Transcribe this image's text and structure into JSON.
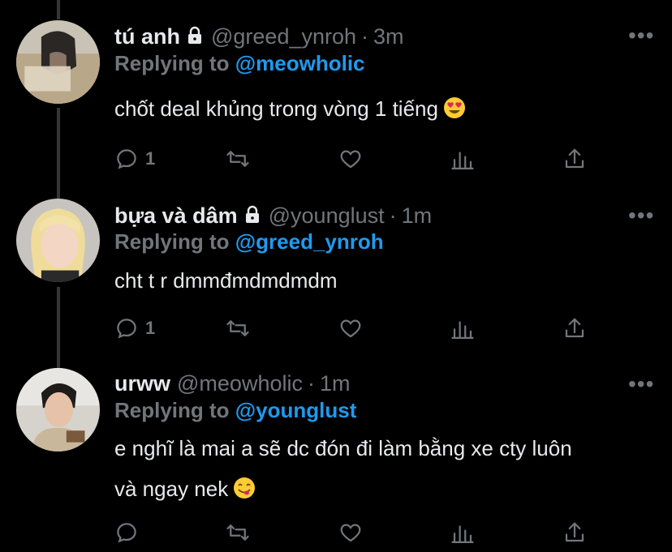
{
  "tweets": [
    {
      "name": "tú anh",
      "handle": "@greed_ynroh",
      "separator": "·",
      "time": "3m",
      "reply_prefix": "Replying to",
      "reply_to": "@meowholic",
      "text": "chốt deal khủng trong vòng 1 tiếng",
      "emoji": "smiling-face-with-heart-eyes",
      "reply_count": "1",
      "retweet_count": "",
      "like_count": ""
    },
    {
      "name": "bựa và dâm",
      "handle": "@younglust",
      "separator": "·",
      "time": "1m",
      "reply_prefix": "Replying to",
      "reply_to": "@greed_ynroh",
      "text": "cht t r dmmđmdmdmdm",
      "reply_count": "1",
      "retweet_count": "",
      "like_count": ""
    },
    {
      "name": "urww",
      "handle": "@meowholic",
      "separator": "·",
      "time": "1m",
      "reply_prefix": "Replying to",
      "reply_to": "@younglust",
      "text_line1": "e nghĩ là mai a sẽ dc đón đi làm bằng xe cty luôn",
      "text_line2": "và ngay nek",
      "emoji": "face-savoring-food",
      "reply_count": "",
      "retweet_count": "",
      "like_count": ""
    }
  ],
  "more_glyph": "•••",
  "colors": {
    "background": "#000000",
    "text": "#e7e9ea",
    "secondary": "#71767b",
    "link": "#1d9bf0",
    "thread_line": "#333639"
  }
}
